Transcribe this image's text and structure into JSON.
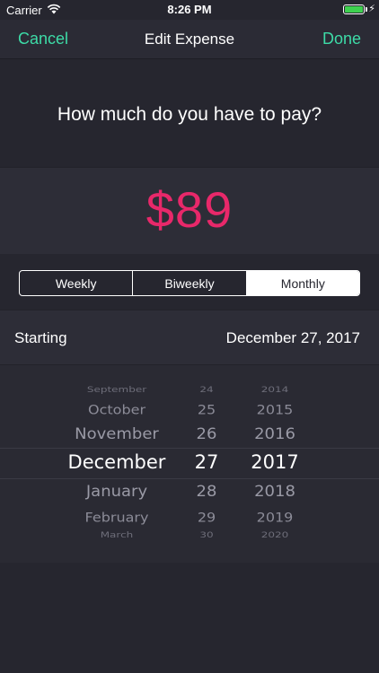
{
  "status_bar": {
    "carrier": "Carrier",
    "time": "8:26 PM",
    "battery_color": "#3ed14f",
    "charging_glyph": "⚡"
  },
  "nav": {
    "cancel_label": "Cancel",
    "title": "Edit Expense",
    "done_label": "Done",
    "accent_color": "#3ddba7"
  },
  "question": "How much do you have to pay?",
  "amount": {
    "value": "$89",
    "color": "#e8286a"
  },
  "frequency": {
    "options": [
      "Weekly",
      "Biweekly",
      "Monthly"
    ],
    "selected": "Monthly"
  },
  "starting": {
    "label": "Starting",
    "value": "December 27, 2017"
  },
  "date_picker": {
    "rows": [
      {
        "month": "September",
        "day": "24",
        "year": "2014"
      },
      {
        "month": "October",
        "day": "25",
        "year": "2015"
      },
      {
        "month": "November",
        "day": "26",
        "year": "2016"
      },
      {
        "month": "December",
        "day": "27",
        "year": "2017"
      },
      {
        "month": "January",
        "day": "28",
        "year": "2018"
      },
      {
        "month": "February",
        "day": "29",
        "year": "2019"
      },
      {
        "month": "March",
        "day": "30",
        "year": "2020"
      }
    ],
    "selected_index": 3
  }
}
